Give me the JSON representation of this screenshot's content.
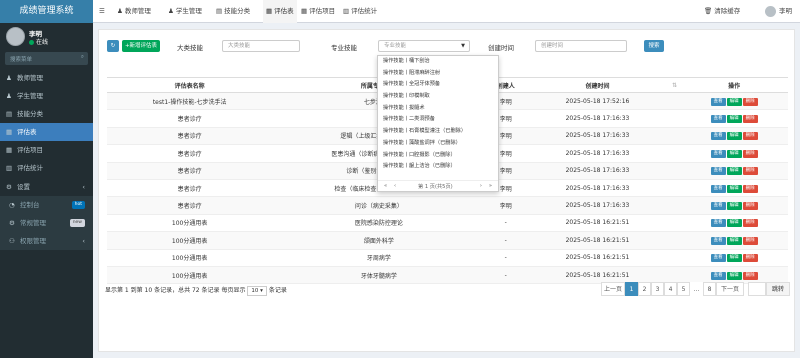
{
  "app": {
    "title": "成绩管理系统"
  },
  "user": {
    "name": "李明",
    "status": "在线"
  },
  "search": {
    "placeholder": "搜索菜单"
  },
  "sidebar": {
    "items": [
      {
        "label": "教师管理",
        "icon": "user-icon"
      },
      {
        "label": "学生管理",
        "icon": "user-icon"
      },
      {
        "label": "技能分类",
        "icon": "file-icon"
      },
      {
        "label": "评估表",
        "icon": "list-icon"
      },
      {
        "label": "评估项目",
        "icon": "list-icon"
      },
      {
        "label": "评估统计",
        "icon": "chart-icon"
      }
    ],
    "settings": {
      "label": "设置"
    },
    "sub": [
      {
        "label": "控制台",
        "badge": "hot"
      },
      {
        "label": "常规管理",
        "badge": "new"
      },
      {
        "label": "权限管理",
        "badge": ""
      }
    ]
  },
  "topnav": {
    "items": [
      "教师管理",
      "学生管理",
      "技能分类",
      "评估表",
      "评估项目",
      "评估统计"
    ],
    "clear": "清除缓存",
    "user": "李明"
  },
  "toolbar": {
    "add": "新增评估表",
    "big_skill_label": "大类技能",
    "big_skill_placeholder": "大类技能",
    "pro_skill_label": "专业技能",
    "pro_skill_placeholder": "专业技能",
    "created_label": "创建时间",
    "created_placeholder": "创建时间",
    "search_btn": "搜索"
  },
  "table": {
    "headers": [
      "评估表名称",
      "所属专业技能",
      "创建人",
      "创建时间",
      "操作"
    ],
    "rows": [
      [
        "test1-操作技能-七步洗手法",
        "七步洗手法",
        "李明",
        "2025-05-18 17:52:16"
      ],
      [
        "患者诊疗",
        "",
        "李明",
        "2025-05-18 17:16:33"
      ],
      [
        "患者诊疗",
        "逻辑（上级汇报+病例书写）",
        "李明",
        "2025-05-18 17:16:33"
      ],
      [
        "患者诊疗",
        "医患沟通（诊断病沟通+治疗计划）",
        "李明",
        "2025-05-18 17:16:33"
      ],
      [
        "患者诊疗",
        "诊断（鉴别诊断+诊断）",
        "李明",
        "2025-05-18 17:16:33"
      ],
      [
        "患者诊疗",
        "检查（临床检查+辅助检查选择）",
        "李明",
        "2025-05-18 17:16:33"
      ],
      [
        "患者诊疗",
        "问诊（病史采集）",
        "李明",
        "2025-05-18 17:16:33"
      ],
      [
        "100分通用表",
        "医院感染防控理论",
        "-",
        "2025-05-18 16:21:51"
      ],
      [
        "100分通用表",
        "颌面外科学",
        "-",
        "2025-05-18 16:21:51"
      ],
      [
        "100分通用表",
        "牙周病学",
        "-",
        "2025-05-18 16:21:51"
      ],
      [
        "100分通用表",
        "牙体牙髓病学",
        "-",
        "2025-05-18 16:21:51"
      ]
    ],
    "actions": {
      "view": "查看",
      "edit": "编辑",
      "del": "删除"
    }
  },
  "dropdown": {
    "items": [
      "操作技能丨桶下刮治",
      "操作技能丨阻滞麻醉注射",
      "操作技能丨全冠牙体预备",
      "操作技能丨印模制取",
      "操作技能丨拔髓术",
      "操作技能丨二类洞预备",
      "操作技能丨石膏模型灌注（已删除）",
      "操作技能丨藻酸盐调拌（已删除）",
      "操作技能丨口腔摄影（已删除）",
      "操作技能丨龈上洁治（已删除）"
    ],
    "pager": "第 1 页(共5页)"
  },
  "footer": {
    "prefix": "显示第 1 到第 10 条记录，总共 72 条记录 每页显示",
    "page_size": "10",
    "suffix": "条记录"
  },
  "pagination": {
    "prev": "上一页",
    "pages": [
      "1",
      "2",
      "3",
      "4",
      "5",
      "...",
      "8"
    ],
    "next": "下一页",
    "goto": "跳转"
  }
}
